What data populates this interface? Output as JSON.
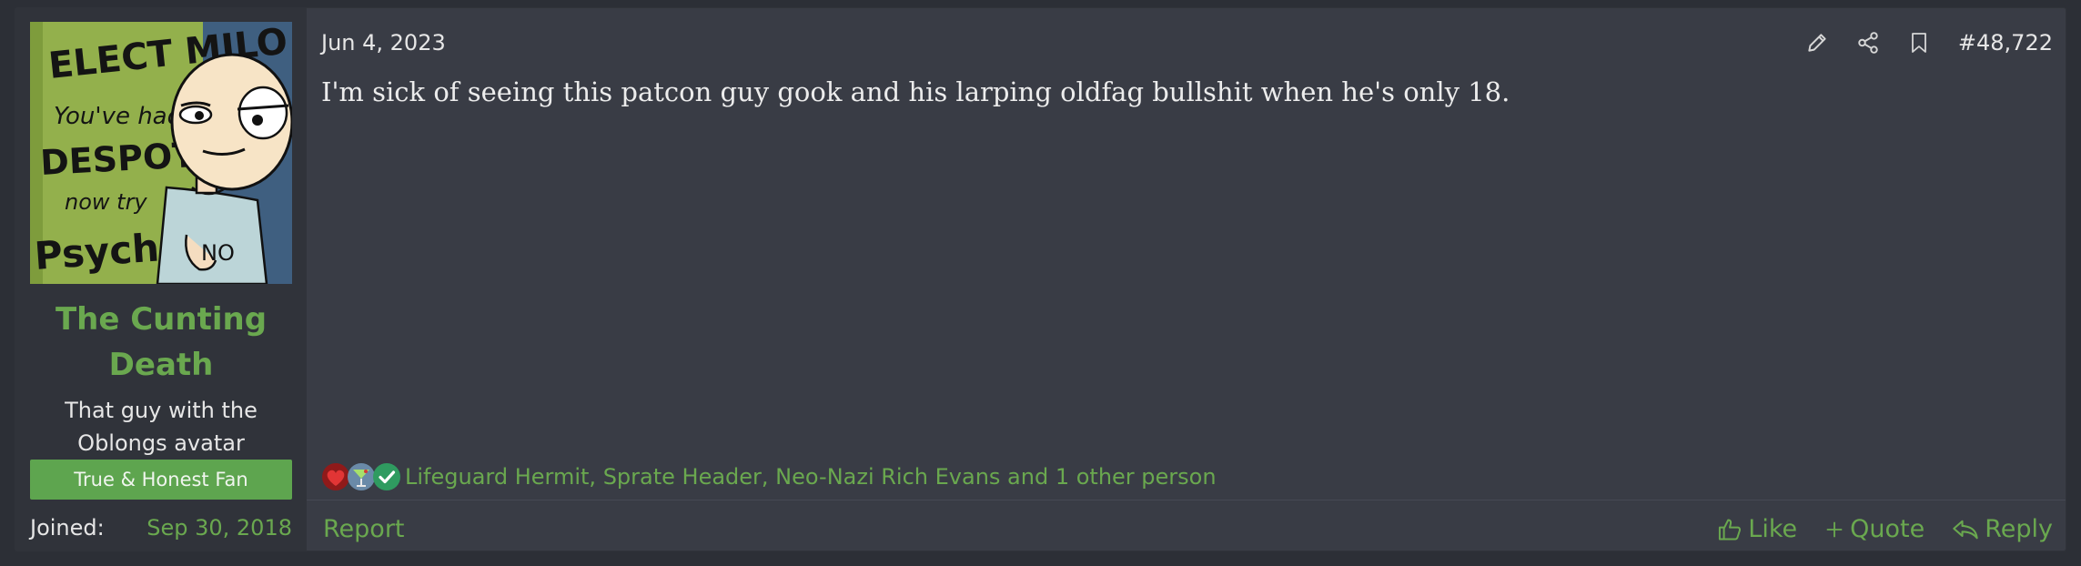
{
  "user": {
    "name": "The Cunting Death",
    "title_line1": "That guy with the",
    "title_line2": "Oblongs avatar",
    "banner": "True & Honest Fan",
    "joined_label": "Joined:",
    "joined_date": "Sep 30, 2018",
    "avatar_icon": "cartoon-avatar-icon",
    "avatar_text": {
      "line1": "ELECT MILO",
      "line2": "You've had",
      "line3": "DESPOTIC",
      "line4": "now try",
      "line5": "Psychotic",
      "shirt": "NO"
    }
  },
  "post": {
    "date": "Jun 4, 2023",
    "number": "#48,722",
    "message": "I'm sick of seeing this patcon guy gook and his larping oldfag bullshit when he's only 18.",
    "tool_icons": [
      "pencil-icon",
      "share-icon",
      "bookmark-icon"
    ]
  },
  "reactions": {
    "icons": [
      "heart-icon",
      "cocktail-icon",
      "check-icon"
    ],
    "text": "Lifeguard Hermit, Sprate Header, Neo-Nazi Rich Evans and 1 other person"
  },
  "footer": {
    "report": "Report",
    "like": "Like",
    "quote": "Quote",
    "reply": "Reply"
  },
  "colors": {
    "accent": "#6aa84f",
    "panel": "#393c45",
    "user_panel": "#30333a",
    "banner": "#5ea54f"
  }
}
